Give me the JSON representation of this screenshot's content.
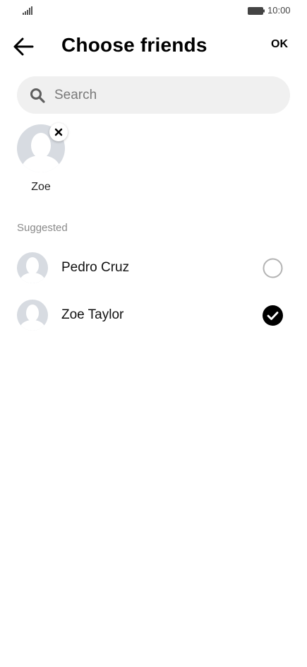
{
  "status_bar": {
    "time": "10:00",
    "signal_icon": "signal-bars-icon",
    "battery_icon": "battery-icon"
  },
  "header": {
    "back_icon": "arrow-left-icon",
    "title": "Choose friends",
    "ok_label": "OK"
  },
  "search": {
    "icon": "search-icon",
    "placeholder": "Search",
    "value": ""
  },
  "selected": [
    {
      "name": "Zoe",
      "remove_icon": "close-icon"
    }
  ],
  "suggested": {
    "label": "Suggested",
    "friends": [
      {
        "name": "Pedro Cruz",
        "selected": false
      },
      {
        "name": "Zoe Taylor",
        "selected": true
      }
    ]
  },
  "colors": {
    "avatar_bg": "#d7dbe1",
    "avatar_fg": "#ffffff",
    "search_bg": "#f0f0f0",
    "section_label": "#8a8a8a",
    "check_fill": "#000000",
    "radio_border": "#b3b3b3"
  }
}
